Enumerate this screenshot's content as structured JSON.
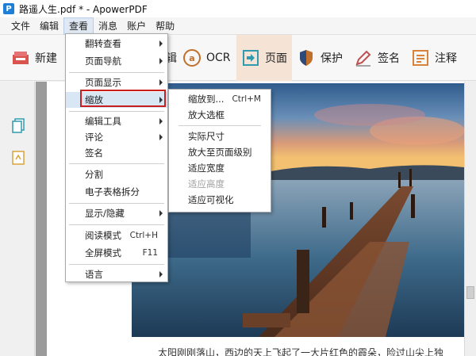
{
  "window": {
    "title": "路遥人生.pdf * - ApowerPDF"
  },
  "menubar": {
    "items": [
      "文件",
      "编辑",
      "查看",
      "消息",
      "账户",
      "帮助"
    ],
    "active": "查看"
  },
  "toolbar": {
    "new_label": "新建",
    "ocr_label": "OCR",
    "page_label": "页面",
    "protect_label": "保护",
    "sign_label": "签名",
    "comment_label": "注释",
    "partial_label": "辑"
  },
  "view_menu": {
    "items": {
      "flip_view": "翻转查看",
      "page_nav": "页面导航",
      "page_display": "页面显示",
      "zoom": "缩放",
      "edit_tools": "编辑工具",
      "comment": "评论",
      "signature": "签名",
      "split": "分割",
      "table_split": "电子表格拆分",
      "show_hide": "显示/隐藏",
      "read_mode": "阅读模式",
      "fullscreen": "全屏模式",
      "language": "语言"
    },
    "shortcuts": {
      "read_mode": "Ctrl+H",
      "fullscreen": "F11"
    }
  },
  "zoom_menu": {
    "items": {
      "zoom_to": "缩放到...",
      "zoom_box": "放大选框",
      "actual_size": "实际尺寸",
      "zoom_page_level": "放大至页面级别",
      "fit_width": "适应宽度",
      "fit_height": "适应高度",
      "fit_visible": "适应可视化"
    },
    "shortcuts": {
      "zoom_to": "Ctrl+M"
    }
  },
  "document": {
    "paragraph": "太阳刚刚落山，西边的天上飞起了一大片红色的霞朵，险过山尖上独"
  },
  "colors": {
    "highlight_box": "#c91f1f",
    "accent": "#1e7fd6",
    "active_tool_bg": "#f5e3d5"
  }
}
